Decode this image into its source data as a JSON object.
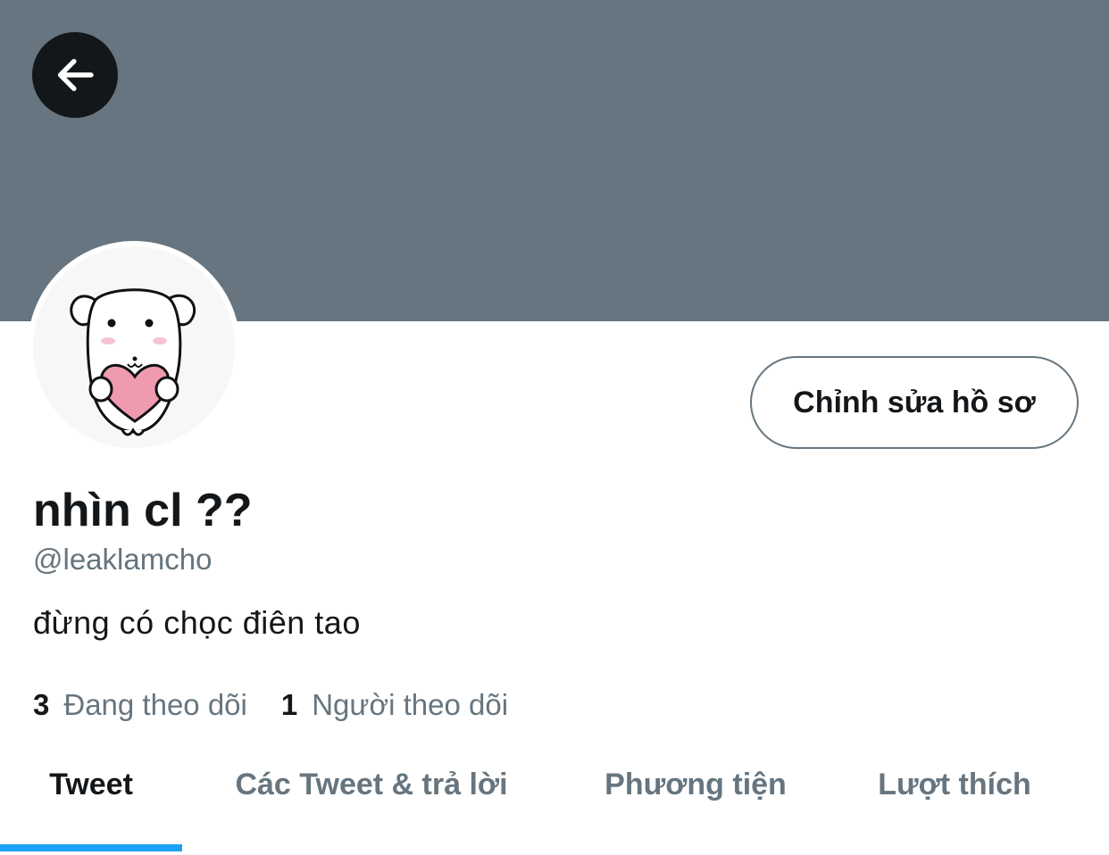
{
  "header": {
    "back_icon": "arrow-left-icon",
    "banner_color": "#66757f"
  },
  "profile": {
    "avatar_icon": "puppy-holding-heart-avatar",
    "edit_button_label": "Chỉnh sửa hồ sơ",
    "display_name": "nhìn cl ??",
    "handle": "@leaklamcho",
    "bio": "đừng có chọc điên tao",
    "following": {
      "count": "3",
      "label": "Đang theo dõi"
    },
    "followers": {
      "count": "1",
      "label": "Người theo dõi"
    }
  },
  "tabs": [
    {
      "label": "Tweet",
      "active": true
    },
    {
      "label": "Các Tweet & trả lời",
      "active": false
    },
    {
      "label": "Phương tiện",
      "active": false
    },
    {
      "label": "Lượt thích",
      "active": false
    }
  ],
  "colors": {
    "accent": "#1da1f2",
    "text_primary": "#14171a",
    "text_secondary": "#66757f"
  }
}
